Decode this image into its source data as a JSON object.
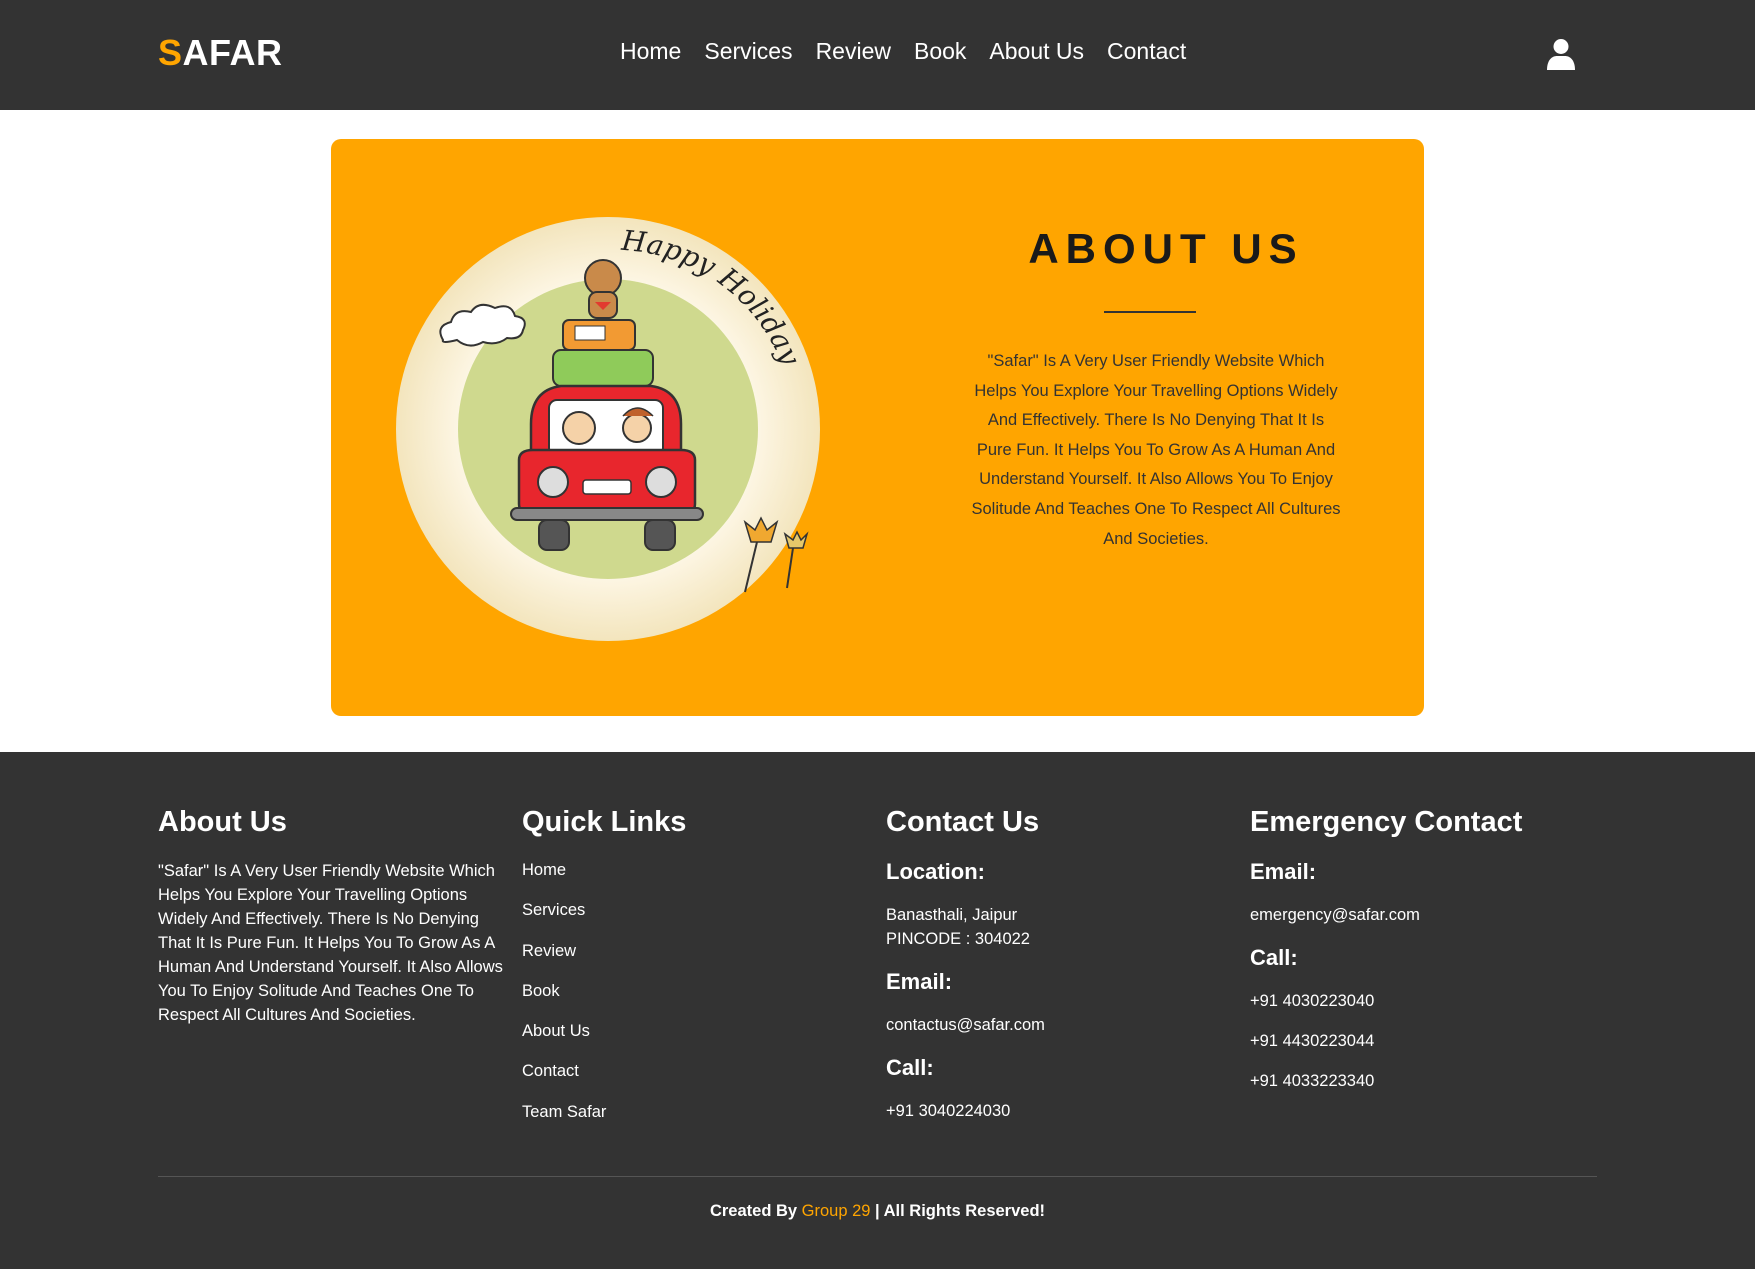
{
  "header": {
    "logo_first": "S",
    "logo_rest": "AFAR",
    "nav": [
      "Home",
      "Services",
      "Review",
      "Book",
      "About Us",
      "Contact"
    ],
    "user_icon": "user-icon"
  },
  "hero": {
    "image_text": "Happy Holiday!",
    "title": "ABOUT US",
    "description": "\"Safar\" Is A Very User Friendly Website Which Helps You Explore Your Travelling Options Widely And Effectively. There Is No Denying That It Is Pure Fun. It Helps You To Grow As A Human And Understand Yourself. It Also Allows You To Enjoy Solitude And Teaches One To Respect All Cultures And Societies."
  },
  "footer": {
    "about": {
      "heading": "About Us",
      "text": "\"Safar\" Is A Very User Friendly Website Which Helps You Explore Your Travelling Options Widely And Effectively. There Is No Denying That It Is Pure Fun. It Helps You To Grow As A Human And Understand Yourself. It Also Allows You To Enjoy Solitude And Teaches One To Respect All Cultures And Societies."
    },
    "quick_links": {
      "heading": "Quick Links",
      "links": [
        "Home",
        "Services",
        "Review",
        "Book",
        "About Us",
        "Contact",
        "Team Safar"
      ]
    },
    "contact": {
      "heading": "Contact Us",
      "location_label": "Location:",
      "location_line1": "Banasthali, Jaipur",
      "location_line2": "PINCODE : 304022",
      "email_label": "Email:",
      "email": "contactus@safar.com",
      "call_label": "Call:",
      "phone": "+91 3040224030"
    },
    "emergency": {
      "heading": "Emergency Contact",
      "email_label": "Email:",
      "email": "emergency@safar.com",
      "call_label": "Call:",
      "phones": [
        "+91 4030223040",
        "+91 4430223044",
        "+91 4033223340"
      ]
    },
    "credit_prefix": "Created By ",
    "credit_group": "Group 29",
    "credit_suffix": " | All Rights Reserved!"
  },
  "colors": {
    "accent": "#ffa500",
    "dark": "#333333"
  }
}
